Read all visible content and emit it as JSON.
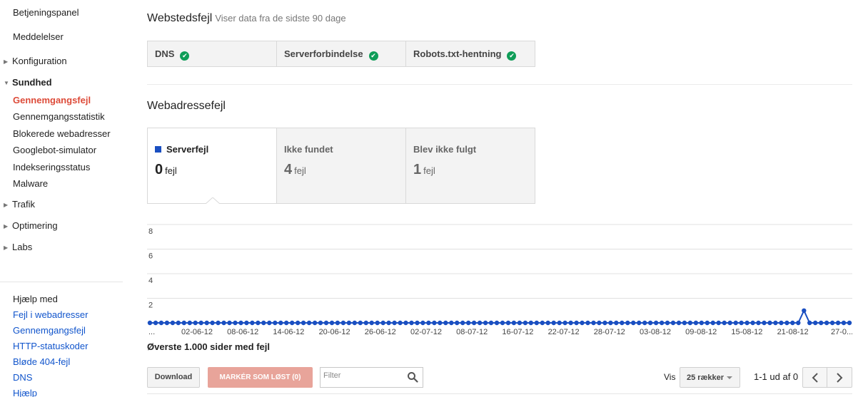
{
  "sidebar": {
    "items": [
      {
        "label": "Betjeningspanel"
      },
      {
        "label": "Meddelelser"
      },
      {
        "label": "Konfiguration"
      },
      {
        "label": "Sundhed"
      },
      {
        "label": "Gennemgangsfejl"
      },
      {
        "label": "Gennemgangsstatistik"
      },
      {
        "label": "Blokerede webadresser"
      },
      {
        "label": "Googlebot-simulator"
      },
      {
        "label": "Indekseringsstatus"
      },
      {
        "label": "Malware"
      },
      {
        "label": "Trafik"
      },
      {
        "label": "Optimering"
      },
      {
        "label": "Labs"
      }
    ],
    "help": {
      "title": "Hjælp med",
      "links": [
        "Fejl i webadresser",
        "Gennemgangsfejl",
        "HTTP-statuskoder",
        "Bløde 404-fejl",
        "DNS",
        "Hjælp"
      ]
    }
  },
  "site_errors": {
    "title": "Webstedsfejl",
    "subtitle": "Viser data fra de sidste 90 dage",
    "boxes": [
      {
        "label": "DNS"
      },
      {
        "label": "Serverforbindelse"
      },
      {
        "label": "Robots.txt-hentning"
      }
    ]
  },
  "url_errors": {
    "title": "Webadressefejl",
    "boxes": [
      {
        "label": "Serverfejl",
        "count": "0",
        "unit": "fejl"
      },
      {
        "label": "Ikke fundet",
        "count": "4",
        "unit": "fejl"
      },
      {
        "label": "Blev ikke fulgt",
        "count": "1",
        "unit": "fejl"
      }
    ]
  },
  "chart_data": {
    "type": "line",
    "ylim": [
      0,
      8
    ],
    "yticks": [
      2,
      4,
      6,
      8
    ],
    "xtick_labels": [
      "...",
      "02-06-12",
      "08-06-12",
      "14-06-12",
      "20-06-12",
      "26-06-12",
      "02-07-12",
      "08-07-12",
      "16-07-12",
      "22-07-12",
      "28-07-12",
      "03-08-12",
      "09-08-12",
      "15-08-12",
      "21-08-12",
      "27-0..."
    ],
    "series": [
      {
        "color": "#1a4fc1",
        "values": [
          0,
          0,
          0,
          0,
          0,
          0,
          0,
          0,
          0,
          0,
          0,
          0,
          0,
          0,
          0,
          0,
          0,
          0,
          0,
          0,
          0,
          0,
          0,
          0,
          0,
          0,
          0,
          0,
          0,
          0,
          0,
          0,
          0,
          0,
          0,
          0,
          0,
          0,
          0,
          0,
          0,
          0,
          0,
          0,
          0,
          0,
          0,
          0,
          0,
          0,
          0,
          0,
          0,
          0,
          0,
          0,
          0,
          0,
          0,
          0,
          0,
          0,
          0,
          0,
          0,
          0,
          0,
          0,
          0,
          0,
          0,
          0,
          0,
          0,
          0,
          0,
          0,
          0,
          0,
          0,
          0,
          0,
          0,
          0,
          0,
          0,
          0,
          0,
          0,
          0,
          0,
          0,
          0,
          0,
          0,
          0,
          0,
          0,
          0,
          0,
          0,
          0,
          0,
          0,
          0,
          0,
          0,
          0,
          0,
          0,
          0,
          0,
          0,
          0,
          0,
          1,
          0,
          0,
          0,
          0,
          0,
          0,
          0,
          0
        ]
      }
    ]
  },
  "top_pages_title": "Øverste 1.000 sider med fejl",
  "toolbar": {
    "download_label": "Download",
    "mark_label": "MARKÉR SOM LØST (0)",
    "filter_placeholder": "Filter",
    "show_label": "Vis",
    "rows_value": "25 rækker",
    "page_range": "1-1 ud af 0"
  },
  "colors": {
    "accent": "#dd4b39",
    "link": "#1155cc",
    "ok": "#0f9d58",
    "series": "#1a4fc1"
  }
}
